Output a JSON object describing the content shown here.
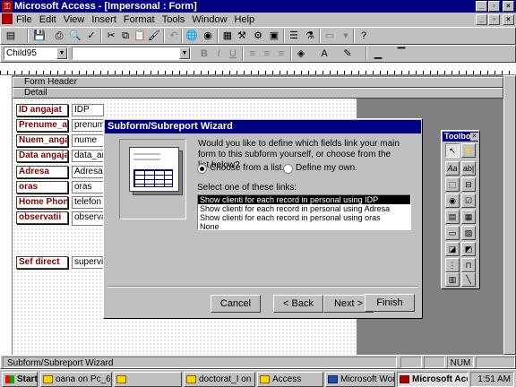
{
  "window": {
    "title": "Microsoft Access - [Impersonal : Form]"
  },
  "menu": [
    "File",
    "Edit",
    "View",
    "Insert",
    "Format",
    "Tools",
    "Window",
    "Help"
  ],
  "format_bar": {
    "object": "Child95",
    "font": "",
    "size": ""
  },
  "form": {
    "sections": {
      "header": "Form Header",
      "detail": "Detail"
    },
    "labels": [
      "ID angajat",
      "Prenume_ang",
      "Nuem_angajat",
      "Data angajarii",
      "Adresa",
      "oras",
      "Home Phone",
      "observatii",
      "Sef direct"
    ],
    "fields": [
      "IDP",
      "prenume",
      "nume",
      "data_ang",
      "Adresa",
      "oras",
      "telefon",
      "observati",
      "supervizo"
    ]
  },
  "wizard": {
    "title": "Subform/Subreport Wizard",
    "question": "Would you like to define which fields link your main form to this subform yourself, or choose from the list below?",
    "option_choose": "Choose from a list.",
    "option_define": "Define my own.",
    "selected_option": "choose",
    "list_label": "Select one of these links:",
    "links": [
      "Show clienti for each record in personal using IDP",
      "Show clienti for each record in personal using Adresa",
      "Show clienti for each record in personal using oras",
      "None"
    ],
    "selected_index": 0,
    "buttons": {
      "cancel": "Cancel",
      "back": "< Back",
      "next": "Next >",
      "finish": "Finish"
    }
  },
  "toolbox": {
    "title": "Toolbox"
  },
  "status": {
    "text": "Subform/Subreport Wizard",
    "num": "NUM"
  },
  "taskbar": {
    "start": "Start",
    "tasks": [
      "oana on Pc_6_1",
      "",
      "doctorat_I on P...",
      "Access",
      "Microsoft Word ...",
      "Microsoft Acc..."
    ],
    "time": "1:51 AM"
  }
}
